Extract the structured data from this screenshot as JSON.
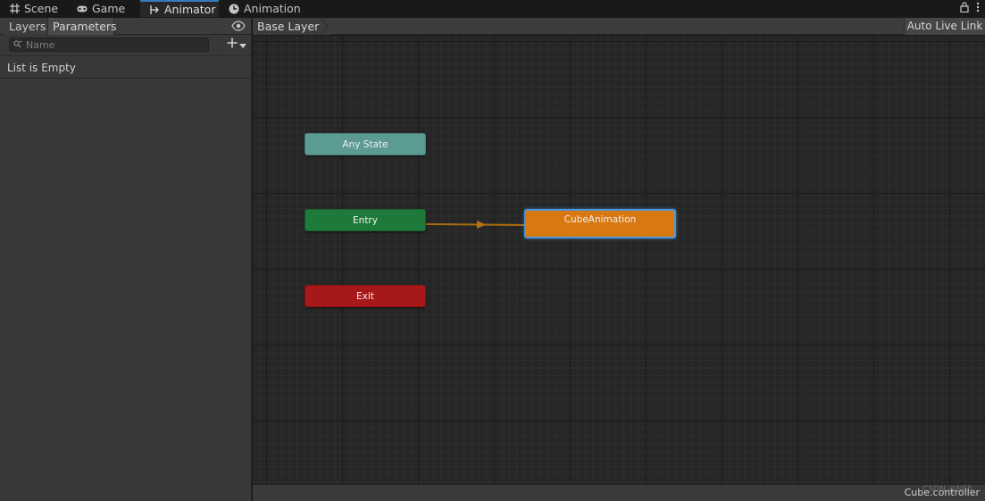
{
  "tabs": [
    {
      "label": "Scene",
      "icon": "grid-icon"
    },
    {
      "label": "Game",
      "icon": "gamepad-icon"
    },
    {
      "label": "Animator",
      "icon": "animator-icon"
    },
    {
      "label": "Animation",
      "icon": "clock-icon"
    }
  ],
  "left_panel": {
    "tabs": {
      "layers": "Layers",
      "parameters": "Parameters"
    },
    "search_placeholder": "Name",
    "empty_message": "List is Empty"
  },
  "graph": {
    "breadcrumb": "Base Layer",
    "auto_live_link": "Auto Live Link",
    "nodes": {
      "any_state": "Any State",
      "entry": "Entry",
      "exit": "Exit",
      "cube_animation": "CubeAnimation"
    },
    "status_label": "Cube.controller",
    "watermark": "CSDN @NE5"
  },
  "colors": {
    "accent": "#3a79bb",
    "any_state": "#5c9a94",
    "entry": "#1d7a3a",
    "exit": "#a71818",
    "default_state": "#d97710",
    "transition": "#a86c0e"
  }
}
